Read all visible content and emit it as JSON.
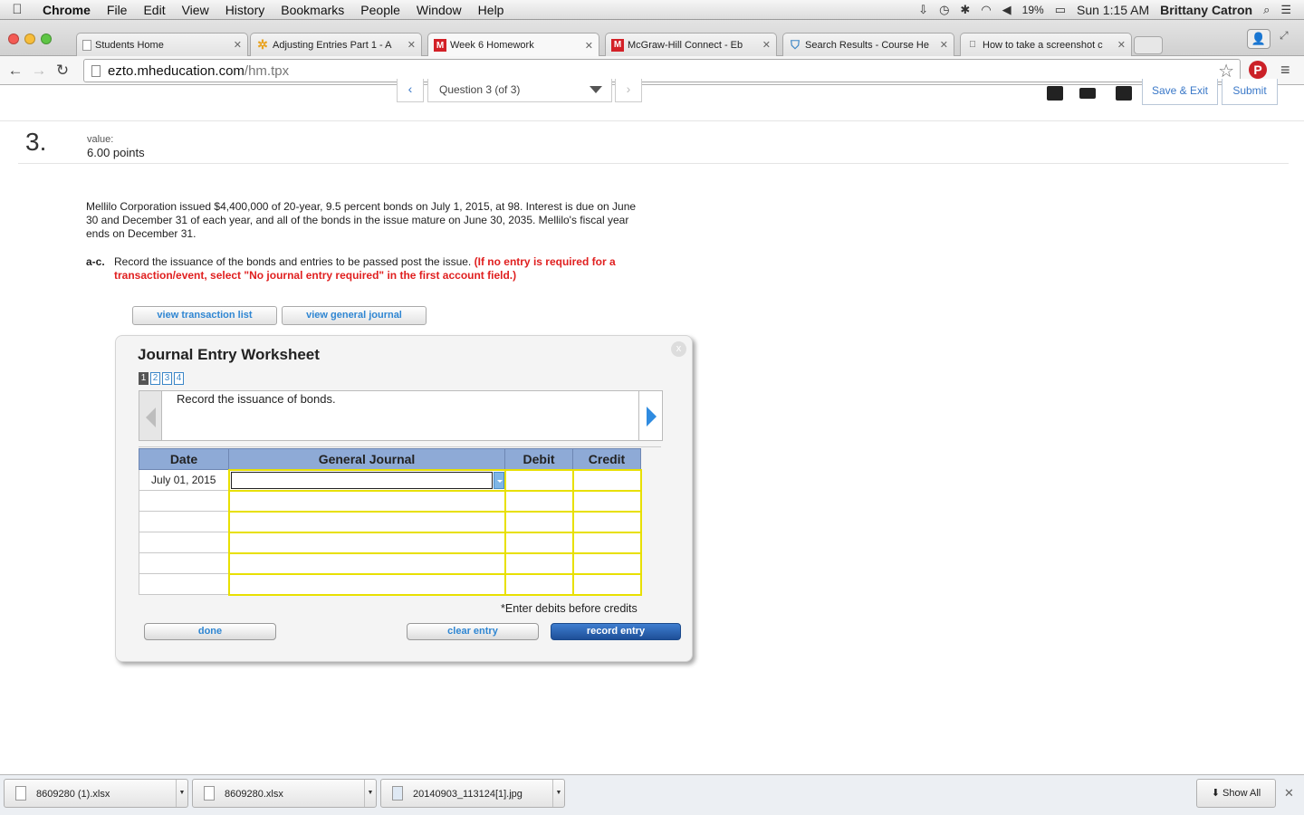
{
  "menubar": {
    "apple": "",
    "items": [
      "Chrome",
      "File",
      "Edit",
      "View",
      "History",
      "Bookmarks",
      "People",
      "Window",
      "Help"
    ],
    "battery": "19%",
    "clock": "Sun 1:15 AM",
    "user": "Brittany Catron",
    "icons": [
      "download-tray-icon",
      "time-machine-icon",
      "bluetooth-icon",
      "wifi-icon",
      "volume-icon",
      "battery-icon",
      "spotlight-icon",
      "notification-center-icon"
    ]
  },
  "tabs": [
    {
      "title": "Students Home",
      "icon": "document-icon"
    },
    {
      "title": "Adjusting Entries Part 1 - A",
      "icon": "star-icon"
    },
    {
      "title": "Week 6 Homework",
      "icon": "mcgraw-m-icon"
    },
    {
      "title": "McGraw-Hill Connect - Eb",
      "icon": "mcgraw-m-icon"
    },
    {
      "title": "Search Results - Course He",
      "icon": "shield-icon"
    },
    {
      "title": "How to take a screenshot c",
      "icon": "apple-icon"
    }
  ],
  "address": {
    "domain": "ezto.mheducation.com",
    "path": "/hm.tpx"
  },
  "question_nav": {
    "select_text": "Question 3 (of 3)",
    "prev": "‹",
    "next": "›",
    "save_exit": "Save & Exit",
    "submit": "Submit"
  },
  "question": {
    "number": "3.",
    "value_label": "value:",
    "points": "6.00 points",
    "problem": "Mellilo Corporation issued $4,400,000 of 20-year, 9.5 percent bonds on July 1, 2015, at 98. Interest is due on June 30 and December 31 of each year, and all of the bonds in the issue mature on June 30, 2035. Mellilo's fiscal year ends on December 31.",
    "part_label": "a-c.",
    "instruction": "Record the issuance of the bonds and entries to be passed post the issue.",
    "instruction_red": "(If no entry is required for a transaction/event, select \"No journal entry required\" in the first account field.)"
  },
  "buttons": {
    "view_transaction_list": "view transaction list",
    "view_general_journal": "view general journal"
  },
  "worksheet": {
    "title": "Journal Entry Worksheet",
    "close": "x",
    "pages": [
      "1",
      "2",
      "3",
      "4"
    ],
    "current_page": "1",
    "description": "Record the issuance of bonds.",
    "columns": {
      "date": "Date",
      "general_journal": "General Journal",
      "debit": "Debit",
      "credit": "Credit"
    },
    "rows": [
      {
        "date": "July 01, 2015"
      },
      {
        "date": ""
      },
      {
        "date": ""
      },
      {
        "date": ""
      },
      {
        "date": ""
      },
      {
        "date": ""
      }
    ],
    "note": "*Enter debits before credits",
    "done": "done",
    "clear_entry": "clear entry",
    "record_entry": "record entry"
  },
  "downloads": [
    {
      "name": "8609280 (1).xlsx"
    },
    {
      "name": "8609280.xlsx"
    },
    {
      "name": "20140903_113124[1].jpg"
    }
  ],
  "show_all": "Show All"
}
